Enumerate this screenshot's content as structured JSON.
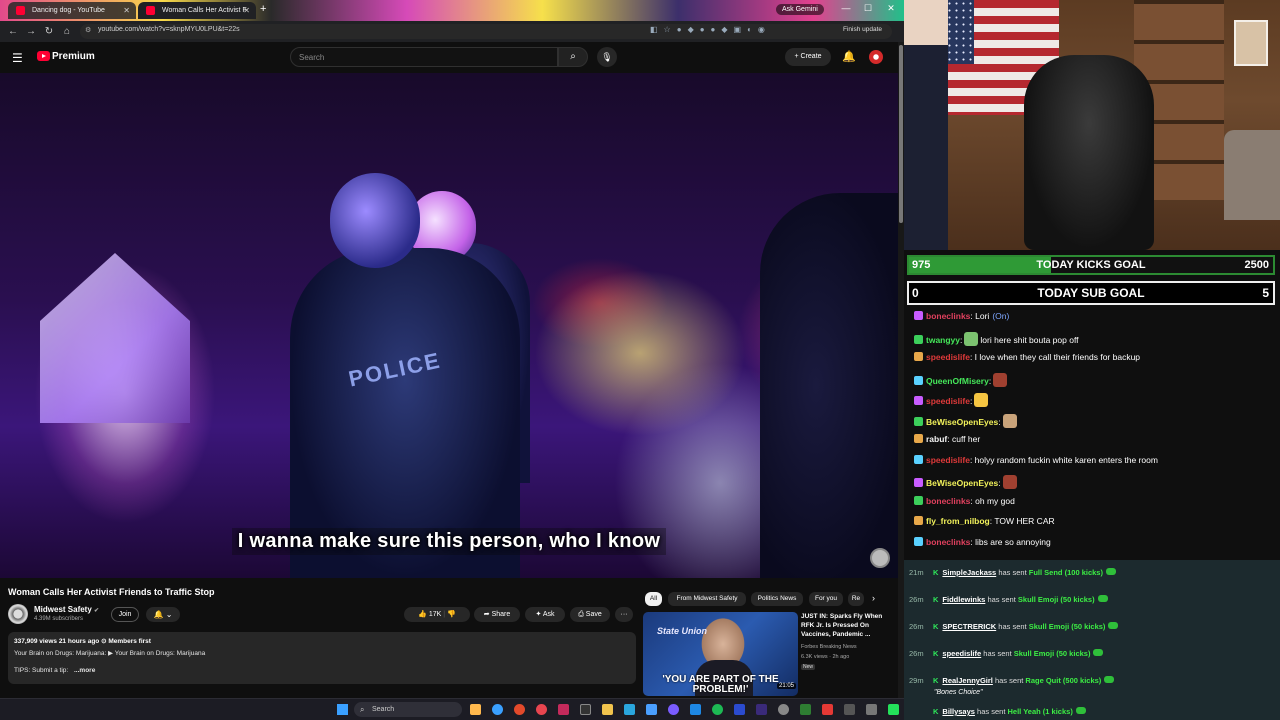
{
  "browser": {
    "tabs": [
      {
        "title": "Dancing dog - YouTube"
      },
      {
        "title": "Woman Calls Her Activist F"
      }
    ],
    "new_tab_icon": "plus-icon",
    "ask_gemini": "Ask Gemini",
    "url": "youtube.com/watch?v=sknpMYU0LPU&t=22s",
    "finish_update": "Finish update"
  },
  "youtube": {
    "brand": "Premium",
    "search_placeholder": "Search",
    "create_label": "Create",
    "video": {
      "caption": "I wanna make sure this person, who I know",
      "scene_text": "POLICE"
    },
    "title": "Woman Calls Her Activist Friends to Traffic Stop",
    "channel": {
      "name": "Midwest Safety",
      "subscribers": "4.39M subscribers",
      "join_label": "Join"
    },
    "actions": {
      "likes": "17K",
      "share": "Share",
      "ask": "Ask",
      "save": "Save",
      "more": "···"
    },
    "description": {
      "meta": "337,909 views  21 hours ago  ⊙ Members first",
      "line1": "Your Brain on Drugs: Marijuana:  ▶ Your Brain on Drugs: Marijuana",
      "line2": "TIPS: Submit a tip:",
      "more": "...more"
    },
    "chips": [
      "All",
      "From Midwest Safety",
      "Politics News",
      "For you",
      "Re"
    ],
    "recommendation": {
      "title": "JUST IN: Sparks Fly When RFK Jr. Is Pressed On Vaccines, Pandemic ...",
      "channel": "Forbes Breaking News",
      "stats": "6.3K views · 2h ago",
      "badge": "New",
      "duration": "21:05",
      "overlay": "'YOU ARE PART OF THE PROBLEM!'",
      "logo": "State Union"
    }
  },
  "stream": {
    "kicks_goal": {
      "current": "975",
      "label": "TODAY KICKS GOAL",
      "target": "2500",
      "progress": 0.39
    },
    "sub_goal": {
      "current": "0",
      "label": "TODAY SUB GOAL",
      "target": "5",
      "progress": 0
    },
    "chat": [
      {
        "user": "boneclinks",
        "color": "pink",
        "text": ": Lori",
        "extra": "(On)"
      },
      {
        "user": "twangyy",
        "color": "green",
        "text": "lori here shit bouta pop off",
        "emote": true
      },
      {
        "user": "speedislife",
        "color": "red",
        "text": ": I love when they call their friends for backup"
      },
      {
        "user": "QueenOfMisery",
        "color": "green",
        "text": ":",
        "emote": true
      },
      {
        "user": "speedislife",
        "color": "red",
        "text": ":",
        "emote": true
      },
      {
        "user": "BeWiseOpenEyes",
        "color": "yellow",
        "text": ":",
        "emote": true
      },
      {
        "user": "rabuf",
        "color": "white",
        "text": ": cuff her"
      },
      {
        "user": "speedislife",
        "color": "red",
        "text": ": holyy random fuckin white karen enters the room"
      },
      {
        "user": "BeWiseOpenEyes",
        "color": "yellow",
        "text": ":",
        "emote": true
      },
      {
        "user": "boneclinks",
        "color": "pink",
        "text": ": oh my god"
      },
      {
        "user": "fly_from_nilbog",
        "color": "yellow",
        "text": ": TOW HER CAR"
      },
      {
        "user": "boneclinks",
        "color": "pink",
        "text": ": libs are so annoying"
      }
    ],
    "gifts": [
      {
        "time": "21m",
        "user": "SimpleJackass",
        "item": "Full Send (100 kicks)"
      },
      {
        "time": "26m",
        "user": "Fiddlewinks",
        "item": "Skull Emoji (50 kicks)"
      },
      {
        "time": "26m",
        "user": "SPECTRERICK",
        "item": "Skull Emoji (50 kicks)"
      },
      {
        "time": "26m",
        "user": "speedislife",
        "item": "Skull Emoji (50 kicks)"
      },
      {
        "time": "29m",
        "user": "RealJennyGirl",
        "item": "Rage Quit (500 kicks)",
        "message": "\"Bones Choice\""
      },
      {
        "time": "",
        "user": "Billysays",
        "item": "Hell Yeah (1 kicks)"
      }
    ],
    "gift_verb": "has sent"
  },
  "taskbar": {
    "search_placeholder": "Search"
  },
  "colors": {
    "youtube_red": "#ff0033",
    "kick_green": "#2f9a36",
    "gift_bg": "#1c2a2e"
  }
}
